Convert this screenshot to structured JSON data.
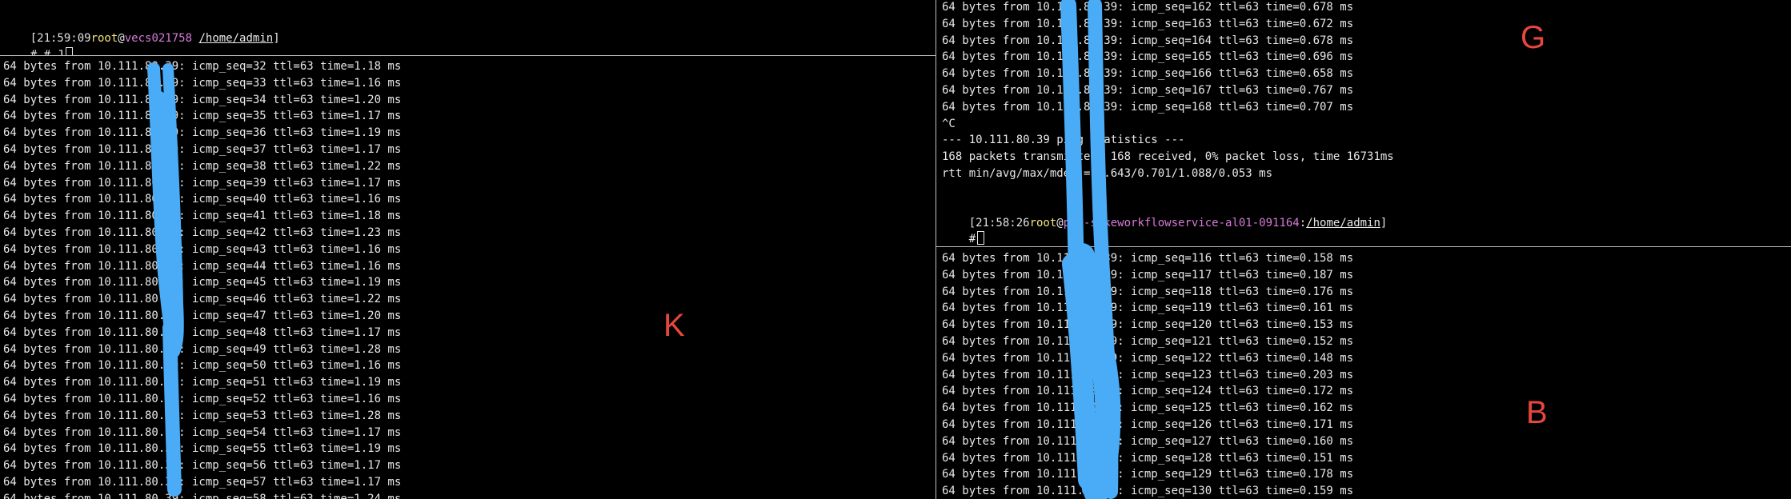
{
  "colors": {
    "background": "#000000",
    "text": "#e8e8e8",
    "prompt_user": "#f4e37a",
    "prompt_host": "#d77ad7",
    "annotation": "#e8473d",
    "redaction": "#4aacf6"
  },
  "top_left_pane": {
    "prompt_time": "[21:59:09",
    "prompt_user": "root",
    "prompt_at": "@",
    "prompt_host": "vecs021758",
    "prompt_sep": " ",
    "prompt_path": "/home/admin",
    "prompt_close": "]",
    "input_line": "# # J"
  },
  "bottom_left_pane": {
    "label": "K",
    "lines": [
      "64 bytes from 10.111.80.39: icmp_seq=32 ttl=63 time=1.18 ms",
      "64 bytes from 10.111.80.39: icmp_seq=33 ttl=63 time=1.16 ms",
      "64 bytes from 10.111.80.39: icmp_seq=34 ttl=63 time=1.20 ms",
      "64 bytes from 10.111.80.39: icmp_seq=35 ttl=63 time=1.17 ms",
      "64 bytes from 10.111.80.39: icmp_seq=36 ttl=63 time=1.19 ms",
      "64 bytes from 10.111.80.39: icmp_seq=37 ttl=63 time=1.17 ms",
      "64 bytes from 10.111.80.39: icmp_seq=38 ttl=63 time=1.22 ms",
      "64 bytes from 10.111.80.39: icmp_seq=39 ttl=63 time=1.17 ms",
      "64 bytes from 10.111.80.39: icmp_seq=40 ttl=63 time=1.16 ms",
      "64 bytes from 10.111.80.39: icmp_seq=41 ttl=63 time=1.18 ms",
      "64 bytes from 10.111.80.39: icmp_seq=42 ttl=63 time=1.23 ms",
      "64 bytes from 10.111.80.39: icmp_seq=43 ttl=63 time=1.16 ms",
      "64 bytes from 10.111.80.39: icmp_seq=44 ttl=63 time=1.16 ms",
      "64 bytes from 10.111.80.39: icmp_seq=45 ttl=63 time=1.19 ms",
      "64 bytes from 10.111.80.39: icmp_seq=46 ttl=63 time=1.22 ms",
      "64 bytes from 10.111.80.39: icmp_seq=47 ttl=63 time=1.20 ms",
      "64 bytes from 10.111.80.39: icmp_seq=48 ttl=63 time=1.17 ms",
      "64 bytes from 10.111.80.39: icmp_seq=49 ttl=63 time=1.28 ms",
      "64 bytes from 10.111.80.39: icmp_seq=50 ttl=63 time=1.16 ms",
      "64 bytes from 10.111.80.39: icmp_seq=51 ttl=63 time=1.19 ms",
      "64 bytes from 10.111.80.39: icmp_seq=52 ttl=63 time=1.16 ms",
      "64 bytes from 10.111.80.39: icmp_seq=53 ttl=63 time=1.28 ms",
      "64 bytes from 10.111.80.39: icmp_seq=54 ttl=63 time=1.17 ms",
      "64 bytes from 10.111.80.39: icmp_seq=55 ttl=63 time=1.19 ms",
      "64 bytes from 10.111.80.39: icmp_seq=56 ttl=63 time=1.17 ms",
      "64 bytes from 10.111.80.39: icmp_seq=57 ttl=63 time=1.17 ms",
      "64 bytes from 10.111.80.39: icmp_seq=58 ttl=63 time=1.24 ms"
    ]
  },
  "top_right_pane": {
    "label": "G",
    "lines": [
      "64 bytes from 10.111.80.39: icmp_seq=162 ttl=63 time=0.678 ms",
      "64 bytes from 10.111.80.39: icmp_seq=163 ttl=63 time=0.672 ms",
      "64 bytes from 10.111.80.39: icmp_seq=164 ttl=63 time=0.678 ms",
      "64 bytes from 10.111.80.39: icmp_seq=165 ttl=63 time=0.696 ms",
      "64 bytes from 10.111.80.39: icmp_seq=166 ttl=63 time=0.658 ms",
      "64 bytes from 10.111.80.39: icmp_seq=167 ttl=63 time=0.767 ms",
      "64 bytes from 10.111.80.39: icmp_seq=168 ttl=63 time=0.707 ms",
      "^C",
      "--- 10.111.80.39 ping statistics ---",
      "168 packets transmitted, 168 received, 0% packet loss, time 16731ms",
      "rtt min/avg/max/mdev = 0.643/0.701/1.088/0.053 ms",
      ""
    ],
    "prompt_time": "[21:58:26",
    "prompt_user": "root",
    "prompt_at": "@",
    "prompt_host": "pro-sokeworkflowservice-al01-091164",
    "prompt_sep": ":",
    "prompt_path": "/home/admin",
    "prompt_close": "]",
    "input_line": "#"
  },
  "bottom_right_pane": {
    "label": "B",
    "lines": [
      "64 bytes from 10.111.80.39: icmp_seq=116 ttl=63 time=0.158 ms",
      "64 bytes from 10.111.80.39: icmp_seq=117 ttl=63 time=0.187 ms",
      "64 bytes from 10.111.80.39: icmp_seq=118 ttl=63 time=0.176 ms",
      "64 bytes from 10.111.80.39: icmp_seq=119 ttl=63 time=0.161 ms",
      "64 bytes from 10.111.80.39: icmp_seq=120 ttl=63 time=0.153 ms",
      "64 bytes from 10.111.80.39: icmp_seq=121 ttl=63 time=0.152 ms",
      "64 bytes from 10.111.80.39: icmp_seq=122 ttl=63 time=0.148 ms",
      "64 bytes from 10.111.80.39: icmp_seq=123 ttl=63 time=0.203 ms",
      "64 bytes from 10.111.80.39: icmp_seq=124 ttl=63 time=0.172 ms",
      "64 bytes from 10.111.80.39: icmp_seq=125 ttl=63 time=0.162 ms",
      "64 bytes from 10.111.80.39: icmp_seq=126 ttl=63 time=0.171 ms",
      "64 bytes from 10.111.80.39: icmp_seq=127 ttl=63 time=0.160 ms",
      "64 bytes from 10.111.80.39: icmp_seq=128 ttl=63 time=0.151 ms",
      "64 bytes from 10.111.80.39: icmp_seq=129 ttl=63 time=0.178 ms",
      "64 bytes from 10.111.80.39: icmp_seq=130 ttl=63 time=0.159 ms"
    ]
  }
}
